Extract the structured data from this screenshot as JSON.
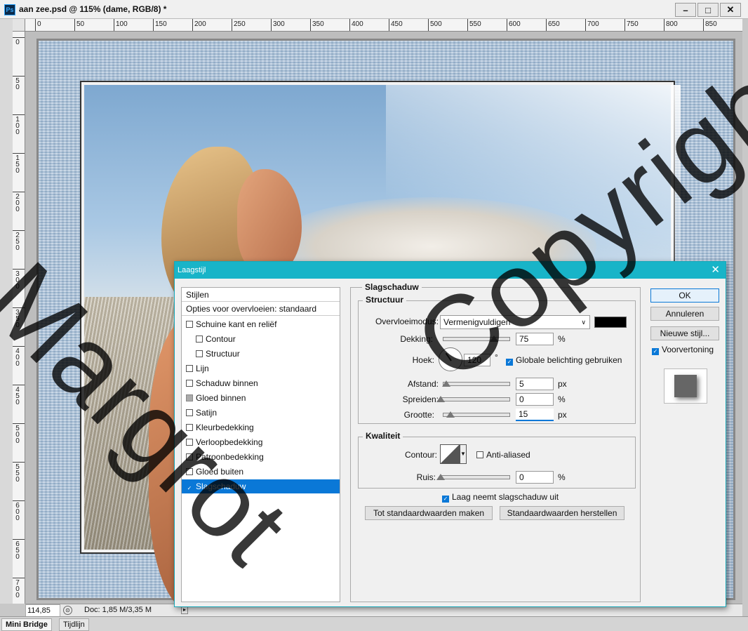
{
  "window": {
    "title": "aan zee.psd @ 115% (dame, RGB/8) *",
    "app_icon": "Ps",
    "minimize": "–",
    "maximize": "□",
    "close": "✕"
  },
  "ruler": {
    "horizontal": [
      "0",
      "50",
      "100",
      "150",
      "200",
      "250",
      "300",
      "350",
      "400",
      "450",
      "500",
      "550",
      "600",
      "650",
      "700",
      "750",
      "800",
      "850"
    ],
    "vertical": [
      "0",
      "50",
      "100",
      "150",
      "200",
      "250",
      "300",
      "350",
      "400",
      "450",
      "500",
      "550",
      "600",
      "650",
      "700"
    ]
  },
  "status": {
    "zoom": "114,85",
    "doc_info": "Doc: 1,85 M/3,35 M",
    "arrow": "▸"
  },
  "bottom_tabs": [
    "Mini Bridge",
    "Tijdlijn"
  ],
  "dialog": {
    "title": "Laagstijl",
    "close": "✕",
    "style_list": {
      "header": "Stijlen",
      "blend_options": "Opties voor overvloeien: standaard",
      "items": [
        {
          "label": "Schuine kant en reliëf",
          "state": "unchecked",
          "sub": false
        },
        {
          "label": "Contour",
          "state": "unchecked",
          "sub": true
        },
        {
          "label": "Structuur",
          "state": "unchecked",
          "sub": true
        },
        {
          "label": "Lijn",
          "state": "unchecked",
          "sub": false
        },
        {
          "label": "Schaduw binnen",
          "state": "unchecked",
          "sub": false
        },
        {
          "label": "Gloed binnen",
          "state": "dim",
          "sub": false
        },
        {
          "label": "Satijn",
          "state": "unchecked",
          "sub": false
        },
        {
          "label": "Kleurbedekking",
          "state": "unchecked",
          "sub": false
        },
        {
          "label": "Verloopbedekking",
          "state": "unchecked",
          "sub": false
        },
        {
          "label": "Patroonbedekking",
          "state": "unchecked",
          "sub": false
        },
        {
          "label": "Gloed buiten",
          "state": "unchecked",
          "sub": false
        },
        {
          "label": "Slagschaduw",
          "state": "checked",
          "sub": false,
          "selected": true
        }
      ]
    },
    "section_title": "Slagschaduw",
    "structure": {
      "title": "Structuur",
      "blend_mode_label": "Overvloeimodus:",
      "blend_mode_value": "Vermenigvuldigen",
      "shadow_color": "#000000",
      "opacity_label": "Dekking:",
      "opacity_value": "75",
      "opacity_unit": "%",
      "opacity_level": 0.75,
      "angle_label": "Hoek:",
      "angle_value": "120",
      "angle_unit": "°",
      "global_light_label": "Globale belichting gebruiken",
      "global_light_checked": true,
      "distance_label": "Afstand:",
      "distance_value": "5",
      "distance_unit": "px",
      "spread_label": "Spreiden:",
      "spread_value": "0",
      "spread_unit": "%",
      "size_label": "Grootte:",
      "size_value": "15",
      "size_unit": "px"
    },
    "quality": {
      "title": "Kwaliteit",
      "contour_label": "Contour:",
      "anti_aliased_label": "Anti-aliased",
      "anti_aliased_checked": false,
      "noise_label": "Ruis:",
      "noise_value": "0",
      "noise_unit": "%"
    },
    "knockout_label": "Laag neemt slagschaduw uit",
    "knockout_checked": true,
    "make_default": "Tot standaardwaarden maken",
    "reset_default": "Standaardwaarden herstellen",
    "buttons": {
      "ok": "OK",
      "cancel": "Annuleren",
      "new_style": "Nieuwe stijl...",
      "preview_label": "Voorvertoning",
      "preview_checked": true
    }
  },
  "watermark": {
    "text_a": "Margrot",
    "text_b": "Copyright"
  },
  "colors": {
    "dialog_title_bg": "#18b4c8",
    "selection": "#0a78d7"
  }
}
